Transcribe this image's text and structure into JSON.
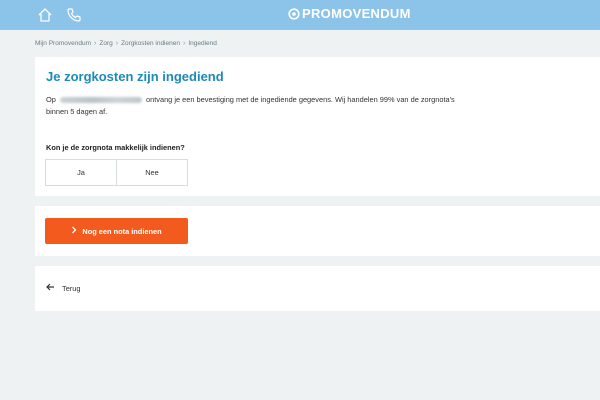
{
  "topbar": {
    "brand": "PROMOVENDUM",
    "home_icon": "home-icon",
    "phone_icon": "phone-icon",
    "color": "#8cc3e8"
  },
  "breadcrumb": [
    "Mijn Promovendum",
    "Zorg",
    "Zorgkosten indienen",
    "Ingediend"
  ],
  "main": {
    "title": "Je zorgkosten zijn ingediend",
    "text_prefix": "Op",
    "text_suffix": "ontvang je een bevestiging met de ingediende gegevens. Wij handelen 99% van de zorgnota's binnen 5 dagen af.",
    "question": "Kon je de zorgnota makkelijk indienen?",
    "options": [
      "Ja",
      "Nee"
    ]
  },
  "cta": {
    "label": "Nog een nota indienen",
    "color": "#f25a1e"
  },
  "back": {
    "label": "Terug"
  },
  "accent": "#1f8ab5"
}
